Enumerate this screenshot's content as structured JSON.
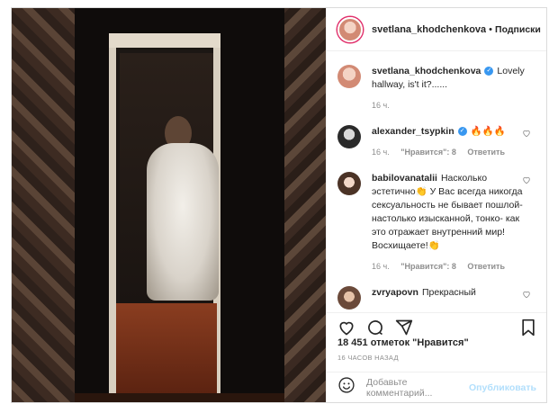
{
  "post": {
    "username": "svetlana_khodchenkova",
    "dot": "•",
    "follow_label": "Подписки",
    "caption_username": "svetlana_khodchenkova",
    "caption_text": "Lovely hallway, is't it?......",
    "caption_time": "16 ч."
  },
  "comments": [
    {
      "username": "alexander_tsypkin",
      "verified": true,
      "text": "🔥🔥🔥",
      "time": "16 ч.",
      "likes": "\"Нравится\": 8",
      "reply": "Ответить"
    },
    {
      "username": "babilovanatalii",
      "verified": false,
      "text": "Насколько эстетично👏 У Вас всегда никогда сексуальность не бывает пошлой- настолько изысканной, тонко- как это отражает внутренний мир! Восхищаете!👏",
      "time": "16 ч.",
      "likes": "\"Нравится\": 8",
      "reply": "Ответить"
    },
    {
      "username": "zvryapovn",
      "verified": false,
      "text": "Прекрасный",
      "time": "",
      "likes": "",
      "reply": ""
    }
  ],
  "actions": {
    "likes_count": "18 451 отметок \"Нравится\"",
    "posted_ago": "16 ЧАСОВ НАЗАД"
  },
  "add_comment": {
    "placeholder": "Добавьте комментарий...",
    "publish_label": "Опубликовать"
  },
  "icons": {
    "like": "heart-icon",
    "comment": "comment-icon",
    "share": "share-icon",
    "save": "bookmark-icon",
    "emoji": "emoji-icon"
  },
  "colors": {
    "verified": "#3897f0",
    "publish_disabled": "#b2dffc",
    "story_ring": "#e1306c",
    "muted": "#8e8e8e"
  }
}
